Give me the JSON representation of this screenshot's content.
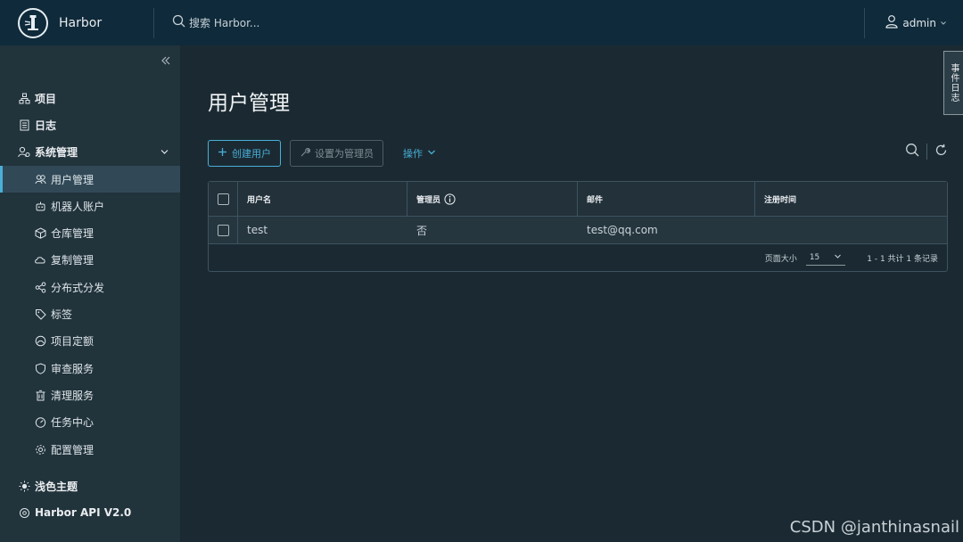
{
  "header": {
    "brand": "Harbor",
    "search_placeholder": "搜索 Harbor...",
    "user": "admin"
  },
  "sidebar": {
    "items": [
      {
        "label": "项目"
      },
      {
        "label": "日志"
      },
      {
        "label": "系统管理"
      }
    ],
    "sub_items": [
      {
        "label": "用户管理"
      },
      {
        "label": "机器人账户"
      },
      {
        "label": "仓库管理"
      },
      {
        "label": "复制管理"
      },
      {
        "label": "分布式分发"
      },
      {
        "label": "标签"
      },
      {
        "label": "项目定额"
      },
      {
        "label": "审查服务"
      },
      {
        "label": "清理服务"
      },
      {
        "label": "任务中心"
      },
      {
        "label": "配置管理"
      }
    ],
    "theme_label": "浅色主题",
    "api_label": "Harbor API V2.0"
  },
  "main": {
    "title": "用户管理",
    "create_button": "创建用户",
    "set_admin_button": "设置为管理员",
    "actions_label": "操作",
    "columns": [
      "用户名",
      "管理员",
      "邮件",
      "注册时间"
    ],
    "rows": [
      {
        "username": "test",
        "admin": "否",
        "email": "test@qq.com",
        "registered": ""
      }
    ],
    "footer": {
      "page_size_label": "页面大小",
      "page_size": "15",
      "summary": "1 - 1 共计 1 条记录"
    }
  },
  "event_log_tab": "事件日志",
  "watermark": "CSDN @janthinasnail",
  "colors": {
    "header_bg": "#0f2a3a",
    "sidebar_bg": "#21333b",
    "main_bg": "#1b2a32",
    "accent": "#49afd9"
  }
}
